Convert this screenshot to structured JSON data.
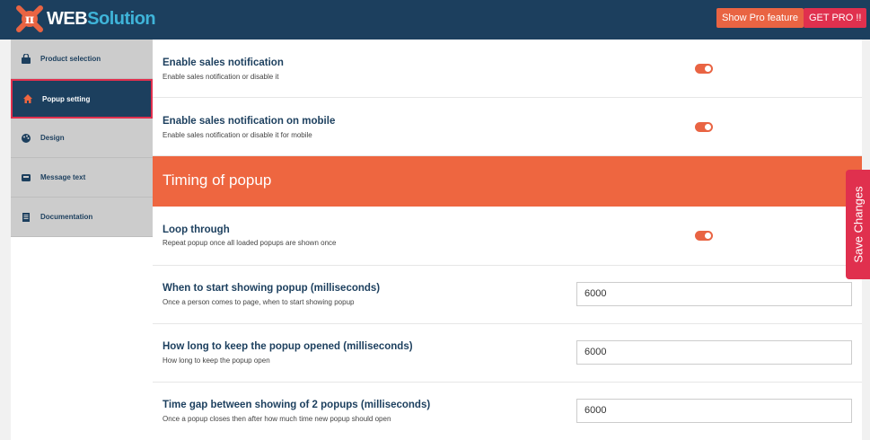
{
  "header": {
    "logo_prefix": "WEB",
    "logo_suffix": "Solution",
    "show_pro_label": "Show Pro feature",
    "get_pro_label": "GET PRO !!"
  },
  "sidebar": {
    "items": [
      {
        "label": "Product selection",
        "icon": "shopping-bag-icon"
      },
      {
        "label": "Popup setting",
        "icon": "home-icon"
      },
      {
        "label": "Design",
        "icon": "palette-icon"
      },
      {
        "label": "Message text",
        "icon": "message-icon"
      },
      {
        "label": "Documentation",
        "icon": "document-icon"
      }
    ],
    "active_index": 1
  },
  "settings": {
    "sales_notification": {
      "title": "Enable sales notification",
      "desc": "Enable sales notification or disable it",
      "enabled": true
    },
    "sales_notification_mobile": {
      "title": "Enable sales notification on mobile",
      "desc": "Enable sales notification or disable it for mobile",
      "enabled": true
    },
    "timing_section_title": "Timing of popup",
    "loop_through": {
      "title": "Loop through",
      "desc": "Repeat popup once all loaded popups are shown once",
      "enabled": true
    },
    "start_showing": {
      "title": "When to start showing popup (milliseconds)",
      "desc": "Once a person comes to page, when to start showing popup",
      "value": "6000"
    },
    "keep_open": {
      "title": "How long to keep the popup opened (milliseconds)",
      "desc": "How long to keep the popup open",
      "value": "6000"
    },
    "time_gap": {
      "title": "Time gap between showing of 2 popups (milliseconds)",
      "desc": "Once a popup closes then after how much time new popup should open",
      "value": "6000"
    }
  },
  "save_label": "Save Changes",
  "colors": {
    "navy": "#1c3f5e",
    "orange": "#e96443",
    "red": "#e0304e",
    "section": "#ee6640"
  }
}
